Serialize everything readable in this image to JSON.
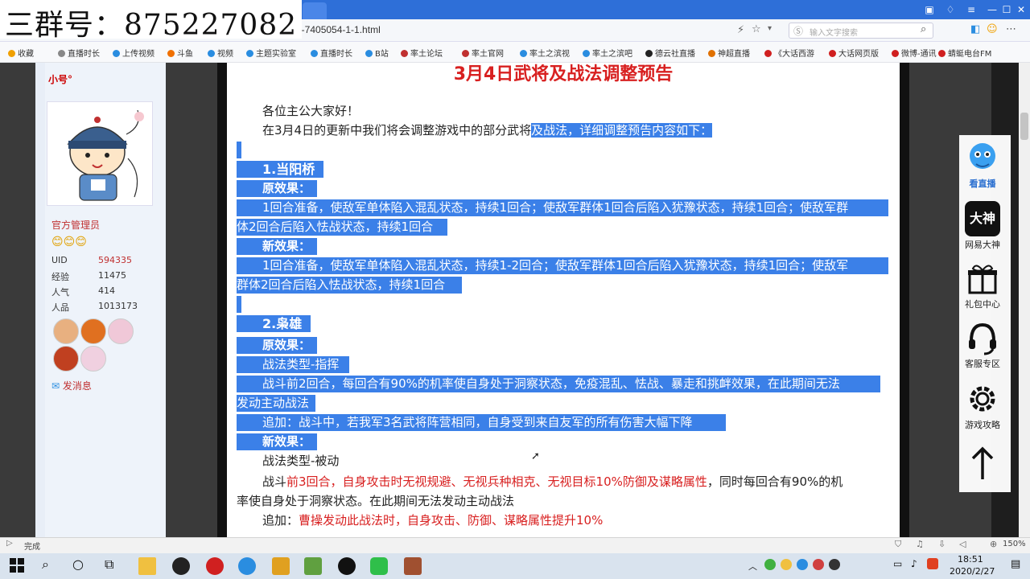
{
  "overlay": {
    "group_label": "三群号：875227082"
  },
  "browser": {
    "url": "d-7405054-1-1.html",
    "search_placeholder": "输入文字搜索",
    "bookmarks": [
      {
        "label": "收藏",
        "color": "#f0a000"
      },
      {
        "label": "直播时长",
        "color": "#888888"
      },
      {
        "label": "上传视频",
        "color": "#2a8de0"
      },
      {
        "label": "斗鱼",
        "color": "#f07000"
      },
      {
        "label": "视频",
        "color": "#2a8de0"
      },
      {
        "label": "主题实验室",
        "color": "#2a8de0"
      },
      {
        "label": "直播时长",
        "color": "#2a8de0"
      },
      {
        "label": "B站",
        "color": "#2a8de0"
      },
      {
        "label": "率土论坛",
        "color": "#c03030"
      },
      {
        "label": "率土官网",
        "color": "#c03030"
      },
      {
        "label": "率土之滨视",
        "color": "#2a8de0"
      },
      {
        "label": "率土之滨吧",
        "color": "#2a8de0"
      },
      {
        "label": "德云社直播",
        "color": "#222222"
      },
      {
        "label": "神超直播",
        "color": "#e07000"
      },
      {
        "label": "《大话西游",
        "color": "#d02020"
      },
      {
        "label": "大话网页版",
        "color": "#d02020"
      },
      {
        "label": "微博-通讯",
        "color": "#d02020"
      },
      {
        "label": "蜻蜓电台FM",
        "color": "#d02020"
      }
    ],
    "status_text": "完成",
    "zoom": "150%"
  },
  "profile": {
    "username": "小号°",
    "role": "官方管理员",
    "stars": "😊😊😊",
    "stats": [
      {
        "key": "UID",
        "value": "594335",
        "highlight": true
      },
      {
        "key": "经验",
        "value": "11475",
        "highlight": false
      },
      {
        "key": "人气",
        "value": "414",
        "highlight": false
      },
      {
        "key": "人品",
        "value": "1013173",
        "highlight": false
      }
    ],
    "message_link": "发消息"
  },
  "article": {
    "headline": "3月4日武将及战法调整预告",
    "greeting": "各位主公大家好！",
    "intro_plain": "在3月4日的更新中我们将会调整游戏中的部分武将",
    "intro_sel": "及战法，详细调整预告内容如下：",
    "s1_title": "1.当阳桥",
    "s1_orig_label": "原效果：",
    "s1_orig_1": "1回合准备，使敌军单体陷入混乱状态，持续1回合；使敌军群体1回合后陷入犹豫状态，持续1回合；使敌军群",
    "s1_orig_2": "体2回合后陷入怯战状态，持续1回合",
    "s1_new_label": "新效果：",
    "s1_new_1": "1回合准备，使敌军单体陷入混乱状态，持续1-2回合；使敌军群体1回合后陷入犹豫状态，持续1回合；使敌军",
    "s1_new_2": "群体2回合后陷入怯战状态，持续1回合",
    "s2_title": "2.枭雄",
    "s2_orig_label": "原效果：",
    "s2_type": "战法类型-指挥",
    "s2_orig_1": "战斗前2回合，每回合有90%的机率使自身处于洞察状态，免疫混乱、怯战、暴走和挑衅效果，在此期间无法",
    "s2_orig_2": "发动主动战法",
    "s2_orig_add": "追加：战斗中，若我军3名武将阵营相同，自身受到来自友军的所有伤害大幅下降",
    "s2_new_label": "新效果：",
    "s2_new_type": "战法类型-被动",
    "s2_new_1a": "战斗",
    "s2_new_1b": "前3回合，自身攻击时无视规避、无视兵种相克、无视目标10%防御及谋略属性",
    "s2_new_1c": "，同时每回合有90%的机",
    "s2_new_2": "率使自身处于洞察状态。在此期间无法发动主动战法",
    "s2_new_add_a": "追加：",
    "s2_new_add_b": "曹操发动此战法时，自身攻击、防御、谋略属性提升10%"
  },
  "float_panel": {
    "items": [
      {
        "label": "看直播",
        "icon": "live-mascot-icon"
      },
      {
        "label": "网易大神",
        "icon": "dashen-icon"
      },
      {
        "label": "礼包中心",
        "icon": "gift-icon"
      },
      {
        "label": "客服专区",
        "icon": "headset-icon"
      },
      {
        "label": "游戏攻略",
        "icon": "gear-icon"
      },
      {
        "label": "",
        "icon": "arrow-up-icon"
      }
    ],
    "dashen_text": "大神"
  },
  "taskbar": {
    "time": "18:51",
    "date": "2020/2/27"
  }
}
